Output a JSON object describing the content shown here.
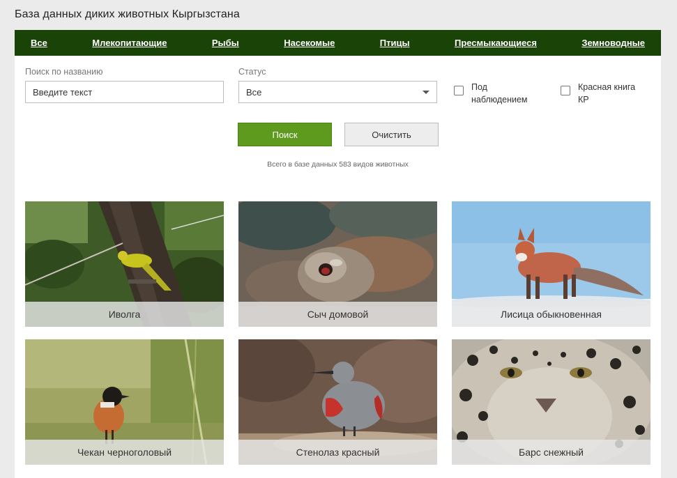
{
  "header": {
    "title": "База данных диких животных Кыргызстана"
  },
  "nav": {
    "items": [
      {
        "label": "Все"
      },
      {
        "label": "Млекопитающие"
      },
      {
        "label": "Рыбы"
      },
      {
        "label": "Насекомые"
      },
      {
        "label": "Птицы"
      },
      {
        "label": "Пресмыкающиеся"
      },
      {
        "label": "Земноводные"
      }
    ]
  },
  "filters": {
    "search_label": "Поиск по названию",
    "search_placeholder": "Введите текст",
    "status_label": "Статус",
    "status_value": "Все",
    "check_observed_line1": "Под",
    "check_observed_line2": "наблюдением",
    "check_redbook_line1": "Красная книга",
    "check_redbook_line2": "КР",
    "search_button": "Поиск",
    "clear_button": "Очистить",
    "total_text": "Всего в базе данных 583 видов животных"
  },
  "colors": {
    "nav_bg": "#1a4407",
    "search_button_bg": "#5d9a1e",
    "page_bg": "#ebebeb"
  },
  "cards": [
    {
      "name": "Иволга"
    },
    {
      "name": "Сыч домовой"
    },
    {
      "name": "Лисица обыкновенная"
    },
    {
      "name": "Чекан черноголовый"
    },
    {
      "name": "Стенолаз красный"
    },
    {
      "name": "Барс снежный"
    }
  ]
}
